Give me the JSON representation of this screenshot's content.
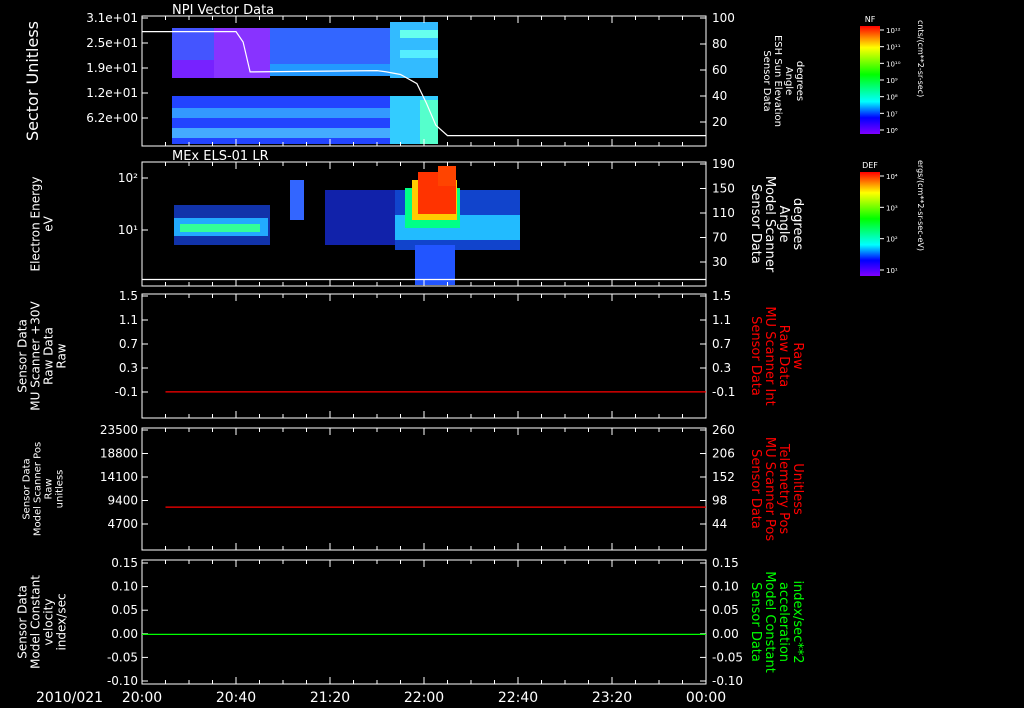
{
  "footer": {
    "date": "2010/021",
    "x_ticks": [
      "20:00",
      "20:40",
      "21:20",
      "22:00",
      "22:40",
      "23:20",
      "00:00"
    ]
  },
  "colors": {
    "background": "#000000",
    "frame": "#ffffff",
    "red_trace": "#ff0000",
    "green_trace": "#00ff00",
    "white_trace": "#ffffff"
  },
  "chart_data": [
    {
      "type": "heatmap",
      "title": "NPI Vector Data",
      "ylabel": "Sector Unitless",
      "y_ticks": [
        "3.1e+01",
        "2.5e+01",
        "1.9e+01",
        "1.2e+01",
        "6.2e+00"
      ],
      "y2label": [
        "Sensor Data",
        "ESH Sun Elevation",
        "Angle",
        "degrees"
      ],
      "y2_ticks": [
        "100",
        "80",
        "60",
        "40",
        "20"
      ],
      "ylim2": [
        0,
        100
      ],
      "colorbar": {
        "name": "NF",
        "labels": [
          "10¹²",
          "10¹¹",
          "10¹⁰",
          "10⁹",
          "10⁸",
          "10⁷",
          "10⁶"
        ],
        "unit": "cnts/(cm**2-sr-sec)"
      },
      "overlay_line": {
        "x": [
          "20:00",
          "20:40",
          "20:43",
          "20:46",
          "21:40",
          "21:44",
          "21:50",
          "21:57",
          "22:01",
          "22:05",
          "22:10",
          "00:00"
        ],
        "y": [
          88,
          88,
          80,
          57,
          58,
          57,
          55,
          48,
          33,
          16,
          8,
          8
        ]
      }
    },
    {
      "type": "heatmap",
      "title": "MEx ELS-01 LR",
      "ylabel": [
        "Electron Energy",
        "eV"
      ],
      "y_ticks": [
        "10²",
        "10¹"
      ],
      "y2label": [
        "Sensor Data",
        "Model Scanner",
        "Angle",
        "degrees"
      ],
      "y2_ticks": [
        "190",
        "150",
        "110",
        "70",
        "30"
      ],
      "ylim2": [
        0,
        190
      ],
      "colorbar": {
        "name": "DEF",
        "labels": [
          "10⁴",
          "10³",
          "10²",
          "10¹"
        ],
        "unit": "ergs/(cm**2-sr-sec-eV)"
      },
      "overlay_line": {
        "x": [
          "20:00",
          "00:00"
        ],
        "y": [
          10,
          10
        ]
      }
    },
    {
      "type": "line",
      "ylabel": [
        "Sensor Data",
        "MU Scanner +30V",
        "Raw Data",
        "Raw"
      ],
      "y_ticks": [
        "1.5",
        "1.1",
        "0.7",
        "0.3",
        "-0.1"
      ],
      "y2label": [
        "Sensor Data",
        "MU Scanner Int",
        "Raw Data",
        "Raw"
      ],
      "y2_ticks": [
        "1.5",
        "1.1",
        "0.7",
        "0.3",
        "-0.1"
      ],
      "ylim": [
        -0.4,
        1.5
      ],
      "series": [
        {
          "color": "#ff0000",
          "x": [
            "20:10",
            "00:00"
          ],
          "y": [
            0,
            0
          ]
        }
      ]
    },
    {
      "type": "line",
      "ylabel": [
        "Sensor Data",
        "Model Scanner Pos",
        "Raw",
        "unitless"
      ],
      "y_ticks": [
        "23500",
        "18800",
        "14100",
        "9400",
        "4700"
      ],
      "y2label": [
        "Sensor Data",
        "MU Scanner Pos",
        "Telemetry Pos",
        "Unitless"
      ],
      "y2_ticks": [
        "260",
        "206",
        "152",
        "98",
        "44"
      ],
      "ylim2": [
        -10,
        260
      ],
      "series": [
        {
          "color": "#ff0000",
          "x": [
            "20:10",
            "00:00"
          ],
          "y": [
            85,
            85
          ]
        }
      ]
    },
    {
      "type": "line",
      "ylabel": [
        "Sensor Data",
        "Model Constant",
        "velocity",
        "index/sec"
      ],
      "y_ticks": [
        "0.15",
        "0.10",
        "0.05",
        "0.00",
        "-0.05",
        "-0.10"
      ],
      "y2label": [
        "Sensor Data",
        "Model Constant",
        "acceleration",
        "index/sec**2"
      ],
      "y2_ticks": [
        "0.15",
        "0.10",
        "0.05",
        "0.00",
        "-0.05",
        "-0.10"
      ],
      "ylim": [
        -0.1,
        0.15
      ],
      "series": [
        {
          "color": "#00ff00",
          "x": [
            "20:00",
            "00:00"
          ],
          "y": [
            0,
            0
          ]
        }
      ]
    }
  ]
}
